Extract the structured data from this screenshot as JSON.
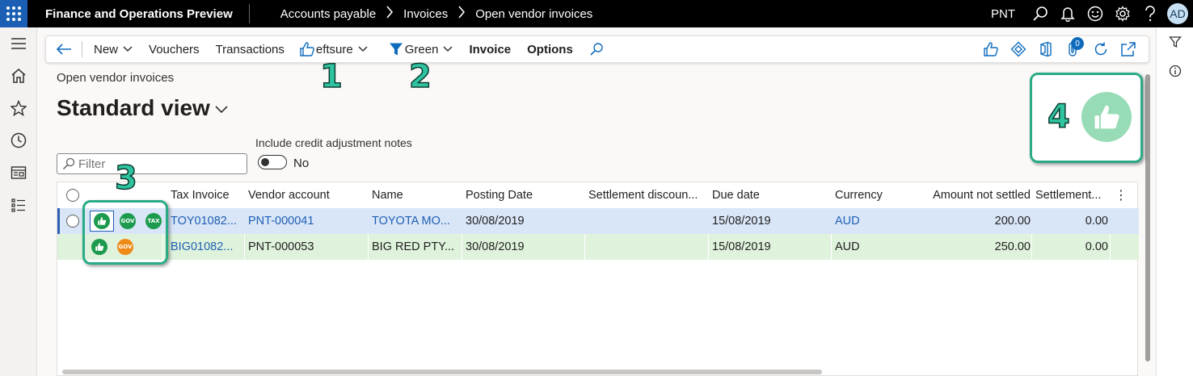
{
  "topbar": {
    "app_name": "Finance and Operations Preview",
    "breadcrumbs": [
      "Accounts payable",
      "Invoices",
      "Open vendor invoices"
    ],
    "company": "PNT",
    "user_initials": "AD"
  },
  "actionpane": {
    "new_label": "New",
    "vouchers_label": "Vouchers",
    "transactions_label": "Transactions",
    "eftsure_label": "eftsure",
    "filter_label": "Green",
    "invoice_label": "Invoice",
    "options_label": "Options",
    "attachments_count": "0"
  },
  "page": {
    "caption": "Open vendor invoices",
    "view_title": "Standard view",
    "filter_placeholder": "Filter",
    "credit_label": "Include credit adjustment notes",
    "credit_value": "No"
  },
  "grid": {
    "columns": [
      "Tax Invoice",
      "Vendor account",
      "Name",
      "Posting Date",
      "Settlement discoun...",
      "Due date",
      "Currency",
      "Amount not settled",
      "Settlement..."
    ],
    "rows": [
      {
        "tax_invoice": "TOY01082...",
        "vendor": "PNT-000041",
        "name": "TOYOTA MO...",
        "posting": "30/08/2019",
        "discount": "",
        "due": "15/08/2019",
        "currency": "AUD",
        "amount": "200.00",
        "settlement": "0.00",
        "badges": [
          "thumbs-up",
          "GOV",
          "TAX"
        ]
      },
      {
        "tax_invoice": "BIG01082...",
        "vendor": "PNT-000053",
        "name": "BIG RED PTY...",
        "posting": "30/08/2019",
        "discount": "",
        "due": "15/08/2019",
        "currency": "AUD",
        "amount": "250.00",
        "settlement": "0.00",
        "badges": [
          "thumbs-up",
          "GOV"
        ]
      }
    ]
  },
  "badges": {
    "gov": "GOV",
    "tax": "TAX"
  },
  "annotations": [
    "1",
    "2",
    "3",
    "4"
  ],
  "colors": {
    "accent": "#0f6cbd",
    "green_status": "#1c9b4e",
    "orange_status": "#ef8a17",
    "annotation": "#29ab85"
  }
}
